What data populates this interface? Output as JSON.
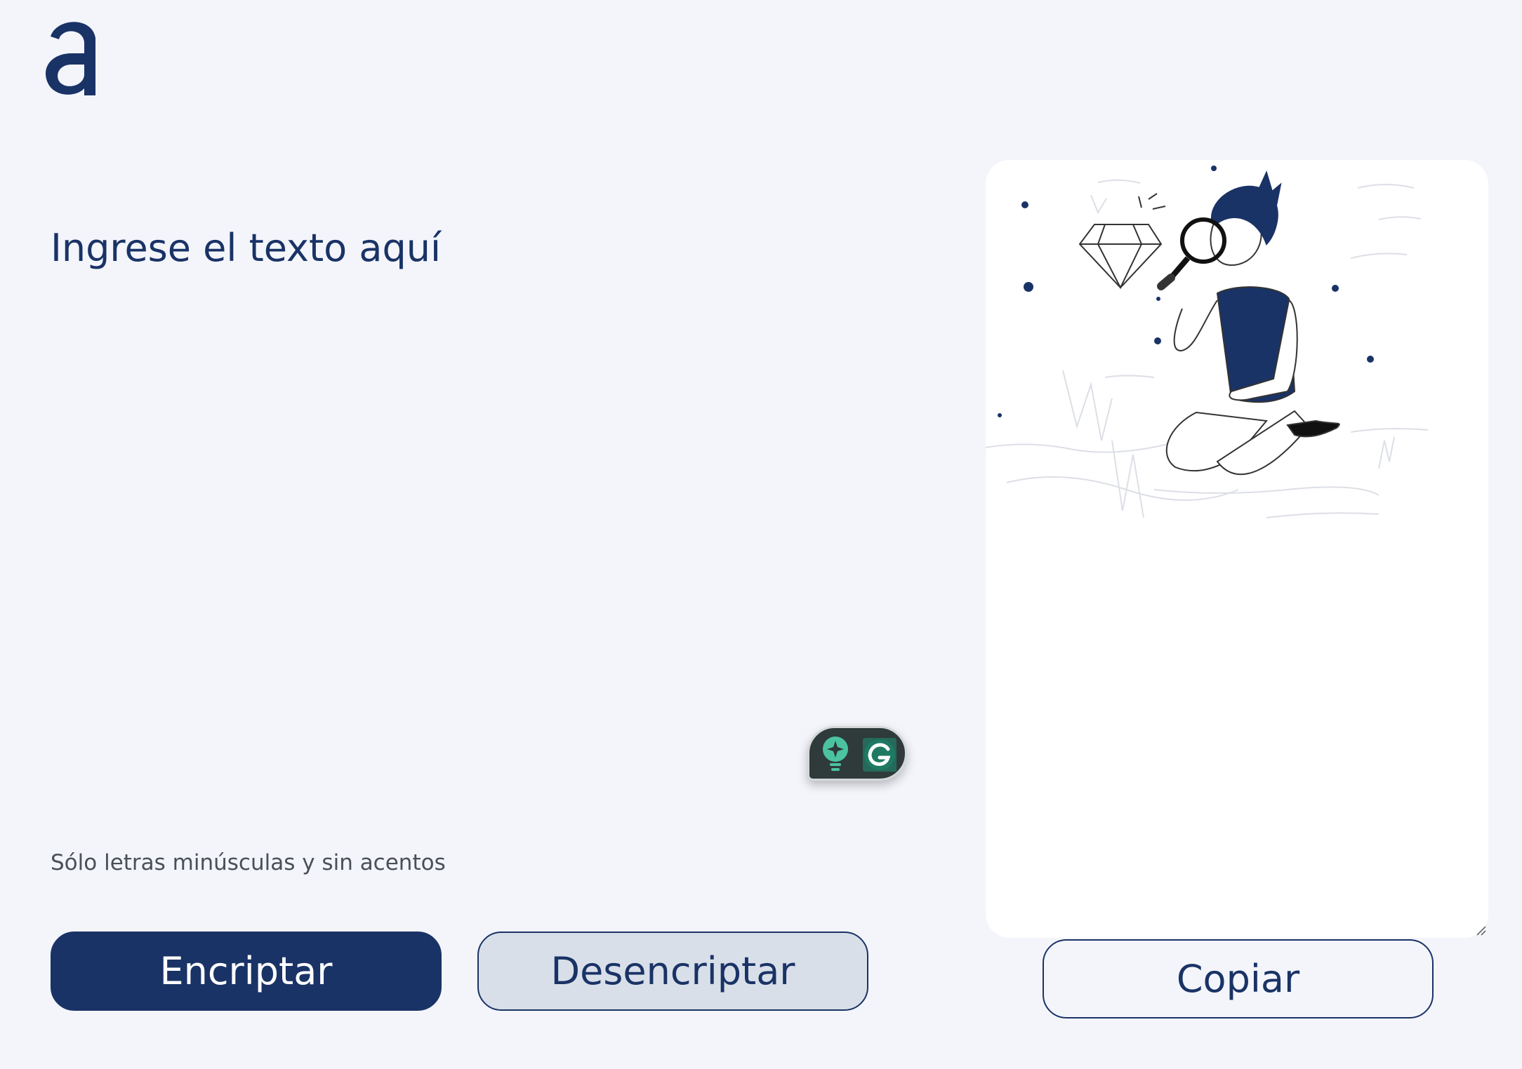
{
  "app": {
    "logo_icon": "alura-a-logo"
  },
  "input": {
    "placeholder": "Ingrese el texto aquí",
    "value": ""
  },
  "hint": {
    "text": "Sólo letras minúsculas y sin acentos"
  },
  "buttons": {
    "encrypt_label": "Encriptar",
    "decrypt_label": "Desencriptar",
    "copy_label": "Copiar"
  },
  "output": {
    "illustration": "person-with-magnifying-glass-examining-diamond"
  },
  "colors": {
    "primary": "#1a3366",
    "background": "#f3f5fb",
    "secondary_button": "#d8dfe9",
    "panel": "#ffffff",
    "hint_text": "#495057"
  }
}
